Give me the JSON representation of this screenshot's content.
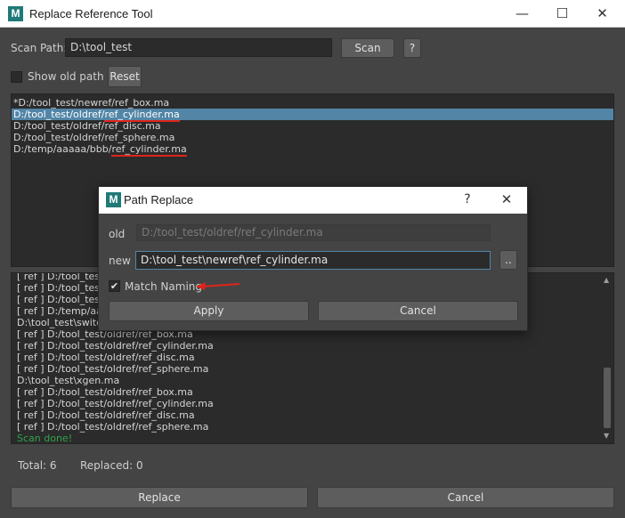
{
  "window": {
    "logo_letter": "M",
    "title": "Replace Reference Tool",
    "minimize_glyph": "—",
    "maximize_glyph": "☐",
    "close_glyph": "✕"
  },
  "scan": {
    "path_label": "Scan Path:",
    "path_value": "D:\\tool_test",
    "scan_button": "Scan",
    "help_button": "?"
  },
  "options": {
    "show_old_path_label": "Show old path",
    "show_old_path_checked": false,
    "reset_button": "Reset"
  },
  "path_list": [
    {
      "prefix": "*D:/tool_test/newref/ref_box.ma",
      "file": "",
      "selected": false
    },
    {
      "prefix": "D:/tool_test/oldref/",
      "file": "ref_cylinder.ma",
      "selected": true
    },
    {
      "prefix": "D:/tool_test/oldref/ref_disc.ma",
      "file": "",
      "selected": false
    },
    {
      "prefix": "D:/tool_test/oldref/ref_sphere.ma",
      "file": "",
      "selected": false
    },
    {
      "prefix": "D:/temp/aaaaa/bbb/",
      "file": "ref_cylinder.ma",
      "selected": false
    }
  ],
  "log_lines": [
    {
      "text": "[ ref ] D:/tool_test/",
      "style": "normal"
    },
    {
      "text": "[ ref ] D:/tool_test/",
      "style": "normal"
    },
    {
      "text": "[ ref ] D:/tool_test/",
      "style": "normal"
    },
    {
      "text": "[ ref ] D:/temp/aaa",
      "style": "normal"
    },
    {
      "text": "D:\\tool_test\\switc",
      "style": "normal"
    },
    {
      "text": "[ ref ] D:/tool_test/oldref/ref_box.ma",
      "style": "normal"
    },
    {
      "text": "[ ref ] D:/tool_test/oldref/ref_cylinder.ma",
      "style": "normal"
    },
    {
      "text": "[ ref ] D:/tool_test/oldref/ref_disc.ma",
      "style": "normal"
    },
    {
      "text": "[ ref ] D:/tool_test/oldref/ref_sphere.ma",
      "style": "normal"
    },
    {
      "text": "D:\\tool_test\\xgen.ma",
      "style": "normal"
    },
    {
      "text": "[ ref ] D:/tool_test/oldref/ref_box.ma",
      "style": "normal"
    },
    {
      "text": "[ ref ] D:/tool_test/oldref/ref_cylinder.ma",
      "style": "normal"
    },
    {
      "text": "[ ref ] D:/tool_test/oldref/ref_disc.ma",
      "style": "normal"
    },
    {
      "text": "[ ref ] D:/tool_test/oldref/ref_sphere.ma",
      "style": "normal"
    },
    {
      "text": "Scan done!",
      "style": "green"
    }
  ],
  "status": {
    "total": "Total: 6",
    "replaced": "Replaced: 0"
  },
  "footer": {
    "replace_button": "Replace",
    "cancel_button": "Cancel"
  },
  "dialog": {
    "logo_letter": "M",
    "title": "Path Replace",
    "help_glyph": "?",
    "close_glyph": "✕",
    "old_label": "old",
    "old_value": "D:/tool_test/oldref/ref_cylinder.ma",
    "new_label": "new",
    "new_value": "D:\\tool_test\\newref\\ref_cylinder.ma",
    "browse_button": "..",
    "match_naming_label": "Match Naming",
    "match_naming_checked": true,
    "apply_button": "Apply",
    "cancel_button": "Cancel"
  },
  "colors": {
    "background": "#444444",
    "selection": "#5285a6",
    "annotation_red": "#e0231b",
    "success_green": "#2ea34a"
  }
}
